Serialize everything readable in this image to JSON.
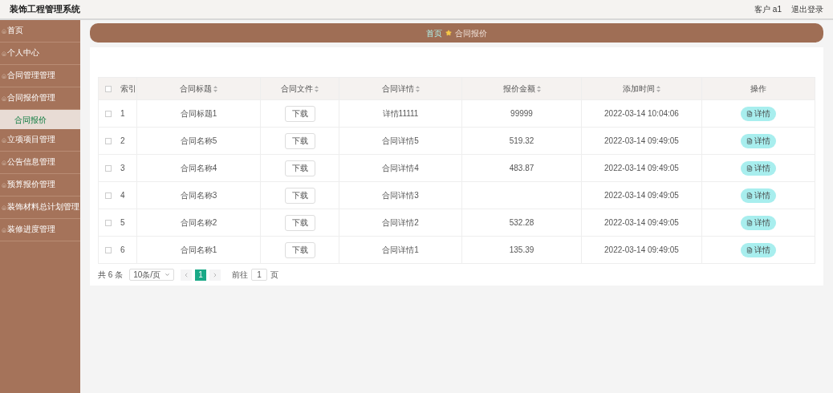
{
  "header": {
    "title": "装饰工程管理系统",
    "user": "客户 a1",
    "logout": "退出登录"
  },
  "sidebar": {
    "items": [
      {
        "label": "首页",
        "selected": false
      },
      {
        "label": "个人中心",
        "selected": false
      },
      {
        "label": "合同管理管理",
        "selected": false
      },
      {
        "label": "合同报价管理",
        "selected": false,
        "children": [
          {
            "label": "合同报价",
            "selected": true
          }
        ]
      },
      {
        "label": "立项项目管理",
        "selected": false
      },
      {
        "label": "公告信息管理",
        "selected": false
      },
      {
        "label": "预算报价管理",
        "selected": false
      },
      {
        "label": "装饰材料总计划管理",
        "selected": false
      },
      {
        "label": "装修进度管理",
        "selected": false
      }
    ]
  },
  "breadcrumb": {
    "home": "首页",
    "current": "合同报价"
  },
  "table": {
    "select_all_checked": false,
    "columns": [
      "索引",
      "合同标题",
      "合同文件",
      "合同详情",
      "报价金额",
      "添加时间",
      "操作"
    ],
    "rows": [
      {
        "index": "1",
        "title": "合同标题1",
        "file": "下载",
        "detail": "详情11111",
        "amount": "99999",
        "time": "2022-03-14 10:04:06",
        "action": "详情",
        "checked": false
      },
      {
        "index": "2",
        "title": "合同名称5",
        "file": "下载",
        "detail": "合同详情5",
        "amount": "519.32",
        "time": "2022-03-14 09:49:05",
        "action": "详情",
        "checked": false
      },
      {
        "index": "3",
        "title": "合同名称4",
        "file": "下载",
        "detail": "合同详情4",
        "amount": "483.87",
        "time": "2022-03-14 09:49:05",
        "action": "详情",
        "checked": false
      },
      {
        "index": "4",
        "title": "合同名称3",
        "file": "下载",
        "detail": "合同详情3",
        "time": "2022-03-14 09:49:05",
        "action": "详情",
        "checked": false
      },
      {
        "index": "5",
        "title": "合同名称2",
        "file": "下载",
        "detail": "合同详情2",
        "amount": "532.28",
        "time": "2022-03-14 09:49:05",
        "action": "详情",
        "checked": false
      },
      {
        "index": "6",
        "title": "合同名称1",
        "file": "下载",
        "detail": "合同详情1",
        "amount": "135.39",
        "time": "2022-03-14 09:49:05",
        "action": "详情",
        "checked": false
      }
    ]
  },
  "pagination": {
    "total": "共 6 条",
    "page_size": "10条/页",
    "pages": [
      {
        "label": "1",
        "selected": true
      }
    ],
    "goto_label": "前往",
    "goto_value": "1",
    "goto_suffix": "页"
  }
}
